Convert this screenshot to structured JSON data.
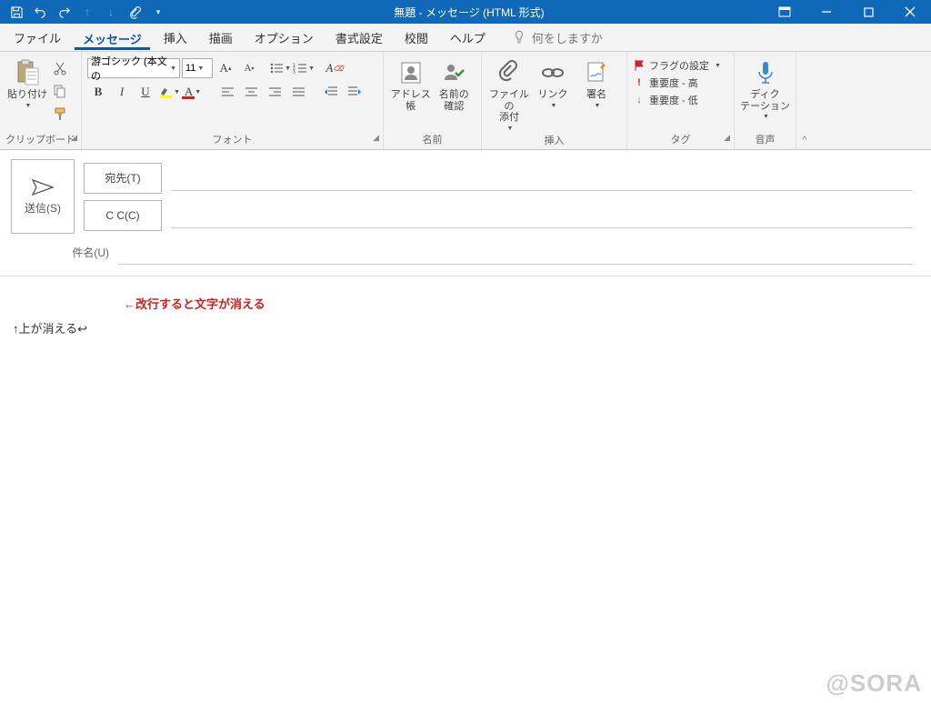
{
  "window": {
    "title": "無題  -  メッセージ (HTML 形式)"
  },
  "tabs": {
    "file": "ファイル",
    "message": "メッセージ",
    "insert": "挿入",
    "draw": "描画",
    "options": "オプション",
    "format": "書式設定",
    "review": "校閲",
    "help": "ヘルプ"
  },
  "tellme": {
    "placeholder": "何をしますか"
  },
  "ribbon": {
    "clipboard": {
      "label": "クリップボード",
      "paste": "貼り付け"
    },
    "font": {
      "label": "フォント",
      "family": "游ゴシック (本文の",
      "size": "11",
      "bold": "B",
      "italic": "I",
      "underline": "U"
    },
    "names": {
      "label": "名前",
      "addressBook": "アドレス帳",
      "checkNames": "名前の\n確認"
    },
    "insert": {
      "label": "挿入",
      "attach": "ファイルの\n添付",
      "link": "リンク",
      "signature": "署名"
    },
    "tags": {
      "label": "タグ",
      "flag": "フラグの設定",
      "high": "重要度 - 高",
      "low": "重要度 - 低"
    },
    "voice": {
      "label": "音声",
      "dictate": "ディク\nテーション"
    }
  },
  "compose": {
    "send": "送信(S)",
    "to": "宛先(T)",
    "cc": "C C(C)",
    "subjectLabel": "件名(U)"
  },
  "body": {
    "annotation": "←改行すると文字が消える",
    "line1": "↑上が消える↩"
  },
  "watermark": "@SORA"
}
